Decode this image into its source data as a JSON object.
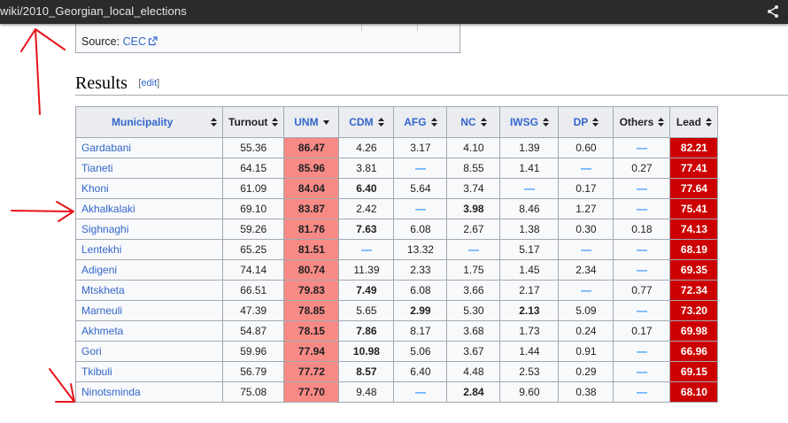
{
  "address_bar": {
    "url": "wiki/2010_Georgian_local_elections",
    "share_icon": "share-icon"
  },
  "source": {
    "prefix": "Source:",
    "link": "CEC",
    "icon": "external-link-icon"
  },
  "section": {
    "title": "Results",
    "edit_open": "[",
    "edit_label": "edit",
    "edit_close": "]"
  },
  "table": {
    "headers": [
      "Municipality",
      "Turnout",
      "UNM",
      "CDM",
      "AFG",
      "NC",
      "IWSG",
      "DP",
      "Others",
      "Lead"
    ],
    "sort_icons": [
      "sort-both-icon",
      "sort-both-icon",
      "sort-desc-icon",
      "sort-both-icon",
      "sort-both-icon",
      "sort-both-icon",
      "sort-both-icon",
      "sort-both-icon",
      "sort-both-icon",
      "sort-both-icon"
    ],
    "rows": [
      [
        "Gardabani",
        "55.36",
        "86.47",
        "4.26",
        "3.17",
        "4.10",
        "1.39",
        "0.60",
        "—",
        "82.21"
      ],
      [
        "Tianeti",
        "64.15",
        "85.96",
        "3.81",
        "—",
        "8.55",
        "1.41",
        "—",
        "0.27",
        "77.41"
      ],
      [
        "Khoni",
        "61.09",
        "84.04",
        "6.40",
        "5.64",
        "3.74",
        "—",
        "0.17",
        "—",
        "77.64"
      ],
      [
        "Akhalkalaki",
        "69.10",
        "83.87",
        "2.42",
        "—",
        "3.98",
        "8.46",
        "1.27",
        "—",
        "75.41"
      ],
      [
        "Sighnaghi",
        "59.26",
        "81.76",
        "7.63",
        "6.08",
        "2.67",
        "1.38",
        "0.30",
        "0.18",
        "74.13"
      ],
      [
        "Lentekhi",
        "65.25",
        "81.51",
        "—",
        "13.32",
        "—",
        "5.17",
        "—",
        "—",
        "68.19"
      ],
      [
        "Adigeni",
        "74.14",
        "80.74",
        "11.39",
        "2.33",
        "1.75",
        "1.45",
        "2.34",
        "—",
        "69.35"
      ],
      [
        "Mtskheta",
        "66.51",
        "79.83",
        "7.49",
        "6.08",
        "3.66",
        "2.17",
        "—",
        "0.77",
        "72.34"
      ],
      [
        "Marneuli",
        "47.39",
        "78.85",
        "5.65",
        "2.99",
        "5.30",
        "2.13",
        "5.09",
        "—",
        "73.20"
      ],
      [
        "Akhmeta",
        "54.87",
        "78.15",
        "7.86",
        "8.17",
        "3.68",
        "1.73",
        "0.24",
        "0.17",
        "69.98"
      ],
      [
        "Gori",
        "59.96",
        "77.94",
        "10.98",
        "5.06",
        "3.67",
        "1.44",
        "0.91",
        "—",
        "66.96"
      ],
      [
        "Tkibuli",
        "56.79",
        "77.72",
        "8.57",
        "6.40",
        "4.48",
        "2.53",
        "0.29",
        "—",
        "69.15"
      ],
      [
        "Ninotsminda",
        "75.08",
        "77.70",
        "9.48",
        "—",
        "2.84",
        "9.60",
        "0.38",
        "—",
        "68.10"
      ]
    ],
    "bold_cells": [
      [],
      [
        4
      ],
      [
        2,
        3
      ],
      [
        5
      ],
      [
        2,
        3
      ],
      [
        3,
        5
      ],
      [
        2
      ],
      [
        2,
        3
      ],
      [
        2,
        4,
        6
      ],
      [
        2,
        3
      ],
      [
        2,
        3
      ],
      [
        2,
        3
      ],
      [
        2,
        5
      ]
    ]
  },
  "colors": {
    "unm": "#f88a86",
    "lead": "#cc0000",
    "link": "#3366cc",
    "dash": "#3399ff",
    "annotation": "#e8141b"
  }
}
